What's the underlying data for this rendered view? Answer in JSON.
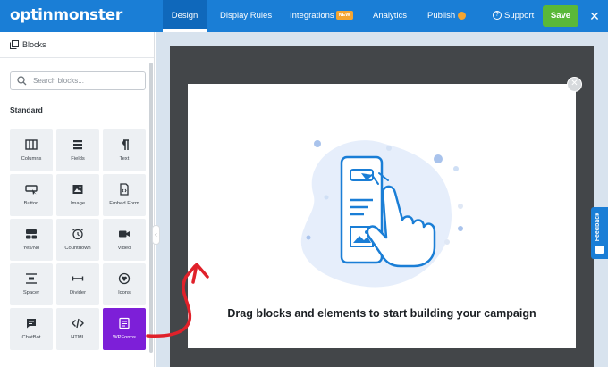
{
  "header": {
    "logo": "optinmonster",
    "tabs": [
      {
        "label": "Design"
      },
      {
        "label": "Display Rules"
      },
      {
        "label": "Integrations",
        "badge": "NEW"
      },
      {
        "label": "Analytics"
      },
      {
        "label": "Publish"
      }
    ],
    "support_label": "Support",
    "save_label": "Save"
  },
  "sidebar": {
    "title": "Blocks",
    "search_placeholder": "Search blocks...",
    "section_label": "Standard",
    "blocks": [
      {
        "label": "Columns",
        "icon": "columns-icon"
      },
      {
        "label": "Fields",
        "icon": "fields-icon"
      },
      {
        "label": "Text",
        "icon": "paragraph-icon"
      },
      {
        "label": "Button",
        "icon": "button-icon"
      },
      {
        "label": "Image",
        "icon": "image-icon"
      },
      {
        "label": "Embed Form",
        "icon": "code-icon"
      },
      {
        "label": "Yes/No",
        "icon": "yes-no-icon"
      },
      {
        "label": "Countdown",
        "icon": "alarm-clock-icon"
      },
      {
        "label": "Video",
        "icon": "video-camera-icon"
      },
      {
        "label": "Spacer",
        "icon": "spacer-icon"
      },
      {
        "label": "Divider",
        "icon": "divider-icon"
      },
      {
        "label": "Icons",
        "icon": "heart-icon"
      },
      {
        "label": "ChatBot",
        "icon": "chat-icon"
      },
      {
        "label": "HTML",
        "icon": "html-code-icon"
      },
      {
        "label": "WPForms",
        "icon": "wpforms-icon"
      }
    ]
  },
  "canvas": {
    "empty_message": "Drag blocks and elements to start building your campaign"
  },
  "feedback_label": "Feedback",
  "colors": {
    "brand_blue": "#1a7ed6",
    "save_green": "#5ab838",
    "selected_purple": "#7d1fd8",
    "annotation_red": "#e0212a",
    "badge_orange": "#f4a531"
  }
}
